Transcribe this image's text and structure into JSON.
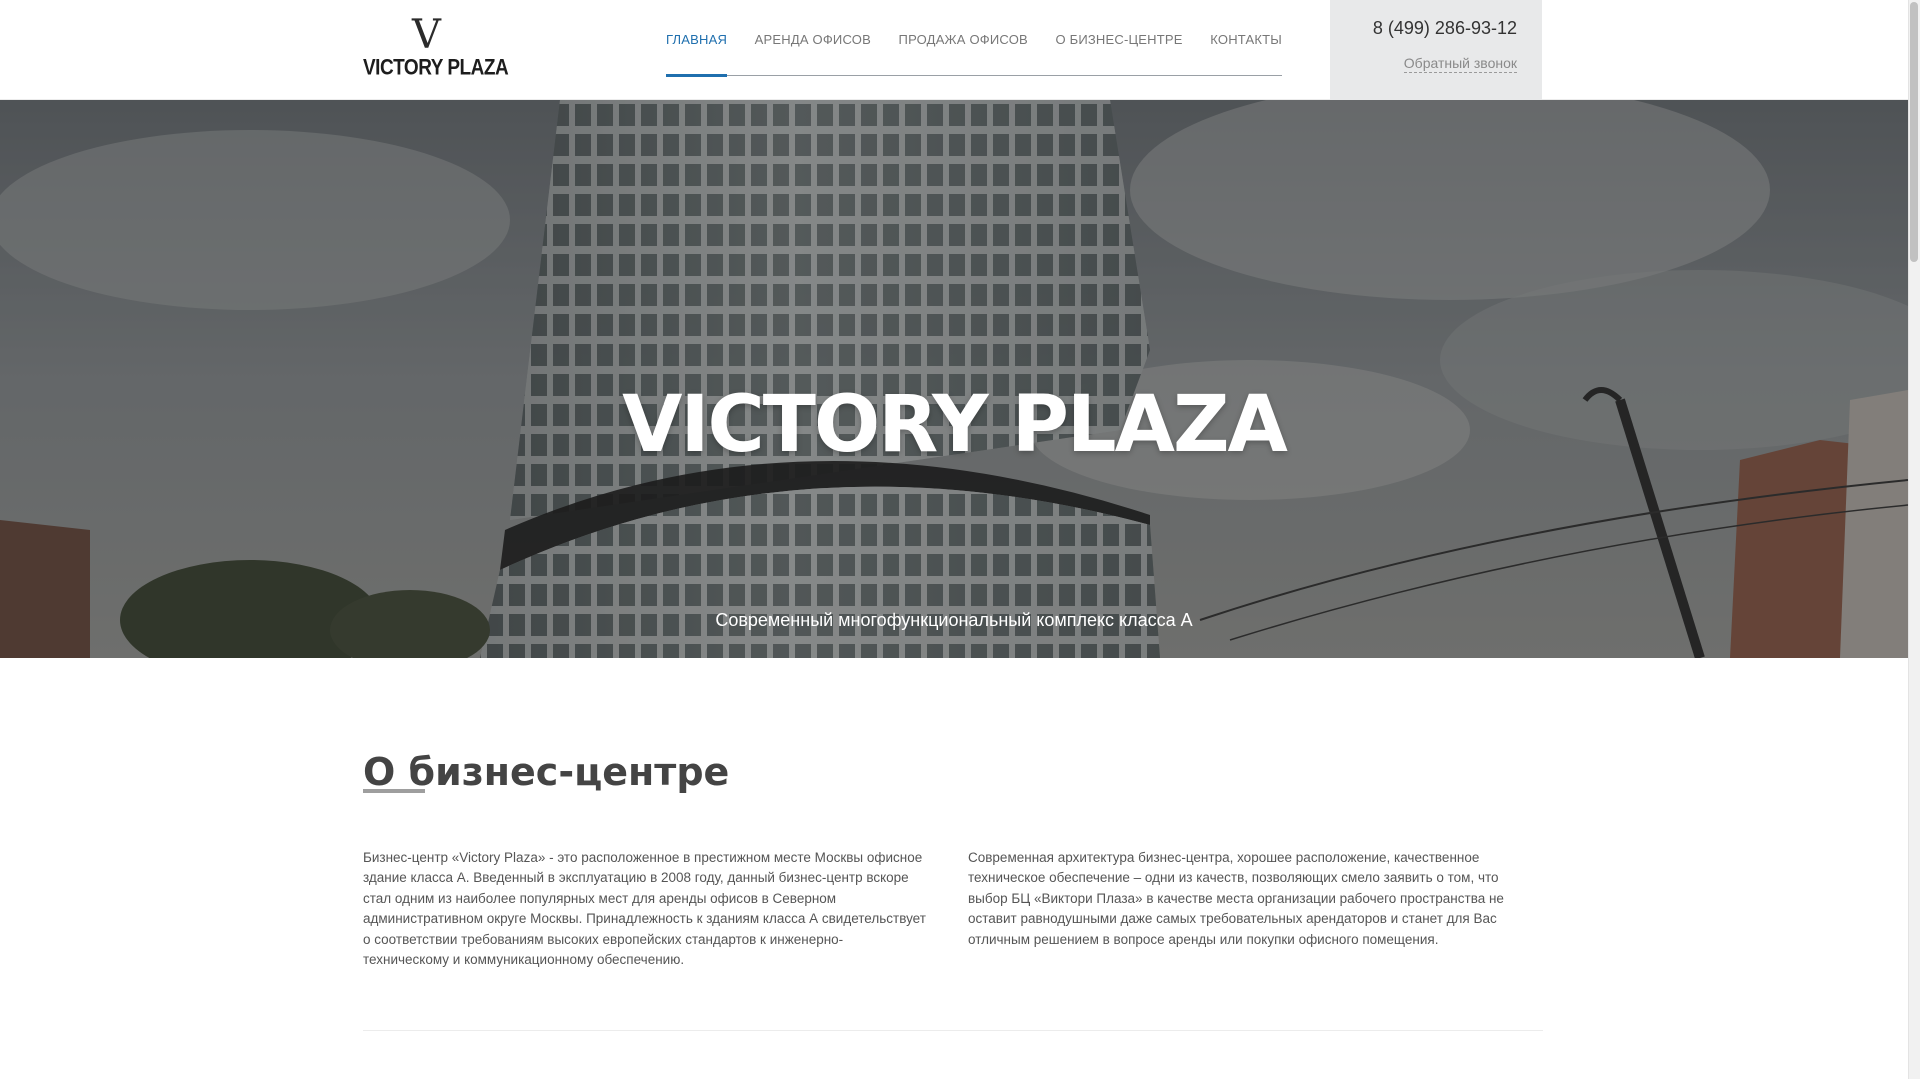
{
  "header": {
    "logo": {
      "mark": "V",
      "text": "VICTORY PLAZA"
    },
    "nav": [
      {
        "label": "ГЛАВНАЯ",
        "active": true
      },
      {
        "label": "АРЕНДА ОФИСОВ",
        "active": false
      },
      {
        "label": "ПРОДАЖА ОФИСОВ",
        "active": false
      },
      {
        "label": "О БИЗНЕС-ЦЕНТРЕ",
        "active": false
      },
      {
        "label": "КОНТАКТЫ",
        "active": false
      }
    ],
    "phone": "8 (499) 286-93-12",
    "callback_label": "Обратный звонок"
  },
  "hero": {
    "title": "VICTORY PLAZA",
    "subtitle": "Современный многофункциональный комплекс класса А"
  },
  "about": {
    "title": "О бизнес-центре",
    "paragraph_left": "Бизнес-центр «Victory Plaza» - это расположенное в престижном месте Москвы офисное здание класса А. Введенный в эксплуатацию в 2008 году, данный бизнес-центр вскоре стал одним из наиболее популярных мест для аренды офисов в Северном административном округе Москвы. Принадлежность к зданиям класса А свидетельствует о соответствии требованиям высоких европейских стандартов к инженерно-техническому и коммуникационному обеспечению.",
    "paragraph_right": "Современная архитектура бизнес-центра, хорошее расположение, качественное техническое обеспечение – одни из качеств, позволяющих смело заявить о том, что выбор БЦ «Виктори Плаза» в качестве места организации рабочего пространства не оставит равнодушными даже самых требовательных арендаторов и станет для Вас отличным решением в вопросе аренды или покупки офисного помещения."
  },
  "colors": {
    "accent": "#1f6fae",
    "contact_bg": "#e8e9ea",
    "text": "#444444"
  }
}
